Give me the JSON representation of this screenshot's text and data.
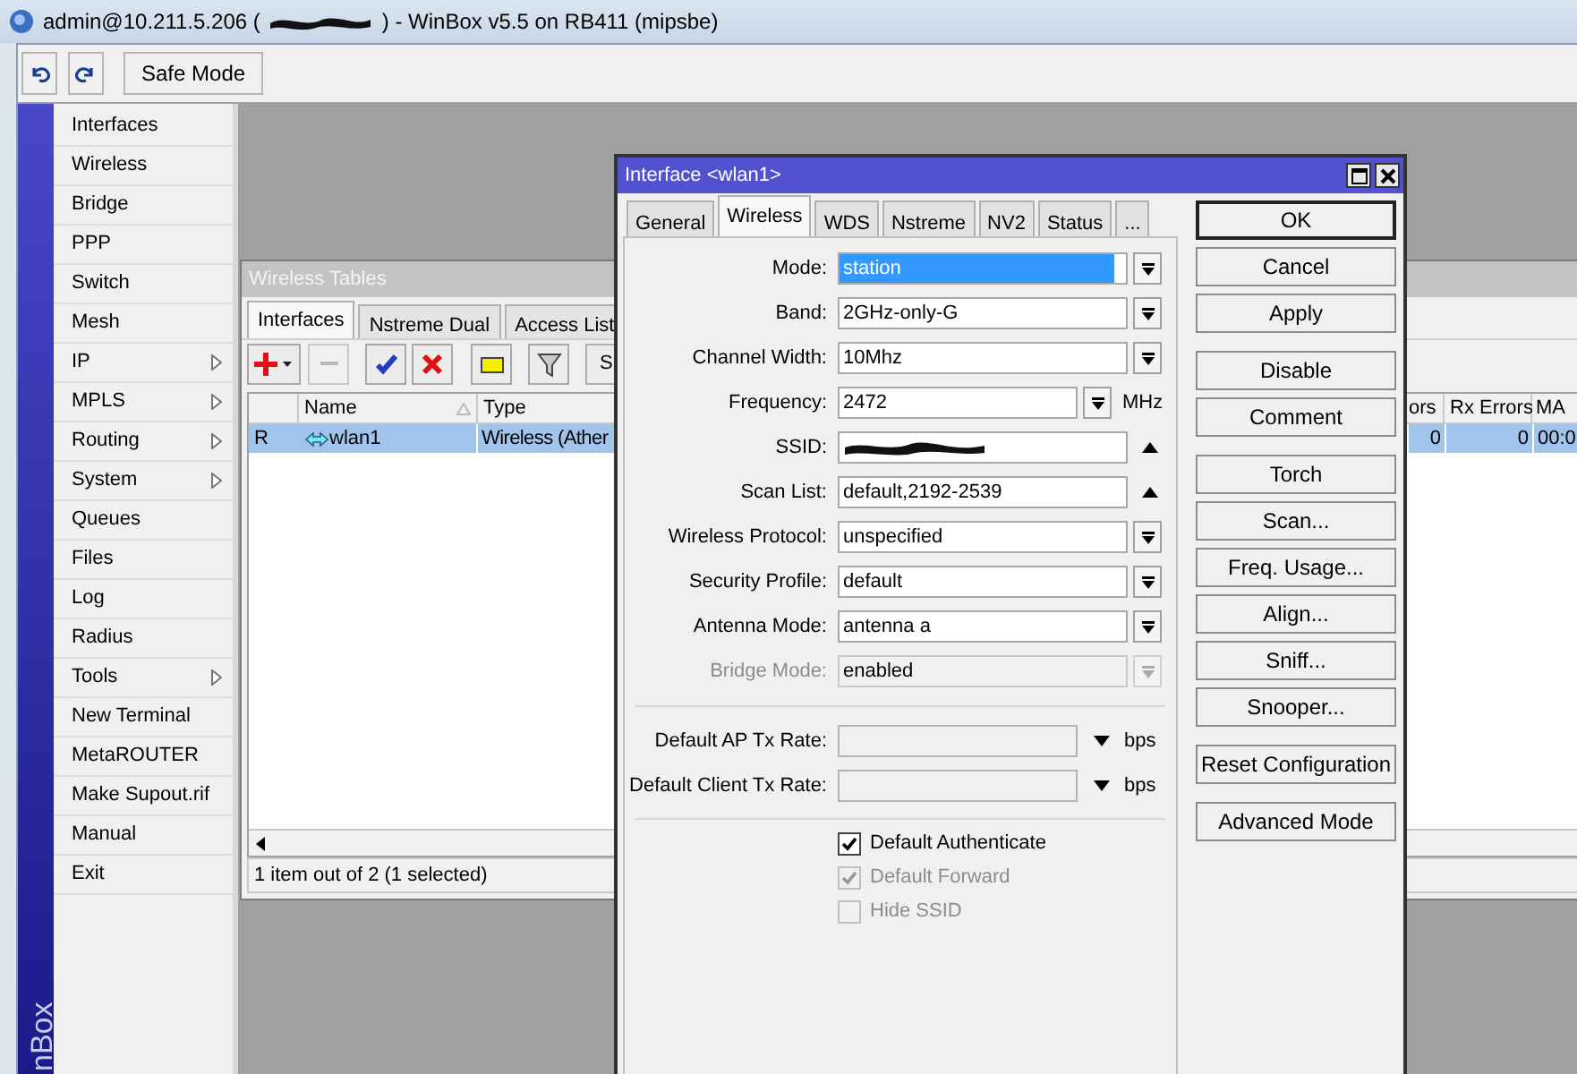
{
  "window": {
    "title_start": "admin@10.211.5.206 (",
    "title_end": ") - WinBox v5.5 on RB411 (mipsbe)"
  },
  "toolbar": {
    "buttons": [
      {
        "kind": "undo"
      },
      {
        "kind": "redo"
      },
      {
        "kind": "text",
        "label": "Safe Mode"
      }
    ]
  },
  "sidebar": {
    "brand": "nBox",
    "items": [
      {
        "label": "Interfaces",
        "submenu": false
      },
      {
        "label": "Wireless",
        "submenu": false
      },
      {
        "label": "Bridge",
        "submenu": false
      },
      {
        "label": "PPP",
        "submenu": false
      },
      {
        "label": "Switch",
        "submenu": false
      },
      {
        "label": "Mesh",
        "submenu": false
      },
      {
        "label": "IP",
        "submenu": true
      },
      {
        "label": "MPLS",
        "submenu": true
      },
      {
        "label": "Routing",
        "submenu": true
      },
      {
        "label": "System",
        "submenu": true
      },
      {
        "label": "Queues",
        "submenu": false
      },
      {
        "label": "Files",
        "submenu": false
      },
      {
        "label": "Log",
        "submenu": false
      },
      {
        "label": "Radius",
        "submenu": false
      },
      {
        "label": "Tools",
        "submenu": true
      },
      {
        "label": "New Terminal",
        "submenu": false
      },
      {
        "label": "MetaROUTER",
        "submenu": false
      },
      {
        "label": "Make Supout.rif",
        "submenu": false
      },
      {
        "label": "Manual",
        "submenu": false
      },
      {
        "label": "Exit",
        "submenu": false
      }
    ]
  },
  "tables_window": {
    "title": "Wireless Tables",
    "tabs": [
      {
        "label": "Interfaces",
        "selected": true
      },
      {
        "label": "Nstreme Dual",
        "selected": false
      },
      {
        "label": "Access List",
        "selected": false
      }
    ],
    "toolbar": [
      {
        "kind": "add",
        "disabled": false
      },
      {
        "kind": "remove",
        "disabled": true
      },
      {
        "kind": "enable",
        "disabled": false
      },
      {
        "kind": "disable",
        "disabled": false
      },
      {
        "kind": "comment",
        "disabled": false
      },
      {
        "kind": "filter",
        "disabled": false
      },
      {
        "kind": "text",
        "label": "S",
        "disabled": false
      }
    ],
    "columns_left": [
      "Name",
      "Type"
    ],
    "columns_right": [
      "ors",
      "Rx Errors",
      "MA"
    ],
    "rows": [
      {
        "flag": "R",
        "name": "wlan1",
        "type": "Wireless (Ather",
        "column_ors": "0",
        "rx_errors": "0",
        "mac": "00:0",
        "selected": true
      }
    ],
    "status": "1 item out of 2 (1 selected)"
  },
  "dialog": {
    "title": "Interface <wlan1>",
    "tabs": [
      {
        "label": "General",
        "selected": false
      },
      {
        "label": "Wireless",
        "selected": true
      },
      {
        "label": "WDS",
        "selected": false
      },
      {
        "label": "Nstreme",
        "selected": false
      },
      {
        "label": "NV2",
        "selected": false
      },
      {
        "label": "Status",
        "selected": false
      },
      {
        "label": "...",
        "selected": false
      }
    ],
    "fields": [
      {
        "kind": "select",
        "label": "Mode:",
        "value": "station",
        "selected": true,
        "disabled": false
      },
      {
        "kind": "select",
        "label": "Band:",
        "value": "2GHz-only-G",
        "selected": false,
        "disabled": false
      },
      {
        "kind": "select",
        "label": "Channel Width:",
        "value": "10Mhz",
        "selected": false,
        "disabled": false
      },
      {
        "kind": "combo",
        "label": "Frequency:",
        "value": "2472",
        "unit": "MHz",
        "selected": false,
        "disabled": false
      },
      {
        "kind": "redacted",
        "label": "SSID:",
        "selected": false,
        "disabled": false
      },
      {
        "kind": "list",
        "label": "Scan List:",
        "value": "default,2192-2539",
        "selected": false,
        "disabled": false
      },
      {
        "kind": "select",
        "label": "Wireless Protocol:",
        "value": "unspecified",
        "selected": false,
        "disabled": false
      },
      {
        "kind": "select",
        "label": "Security Profile:",
        "value": "default",
        "selected": false,
        "disabled": false
      },
      {
        "kind": "select",
        "label": "Antenna Mode:",
        "value": "antenna a",
        "selected": false,
        "disabled": false
      },
      {
        "kind": "select",
        "label": "Bridge Mode:",
        "value": "enabled",
        "selected": false,
        "disabled": true
      }
    ],
    "rates": [
      {
        "label": "Default AP Tx Rate:",
        "unit": "bps"
      },
      {
        "label": "Default Client Tx Rate:",
        "unit": "bps"
      }
    ],
    "checkboxes": [
      {
        "label": "Default Authenticate",
        "checked": true,
        "disabled": false
      },
      {
        "label": "Default Forward",
        "checked": true,
        "disabled": true
      },
      {
        "label": "Hide SSID",
        "checked": false,
        "disabled": true
      }
    ],
    "button_groups": [
      [
        {
          "label": "OK",
          "default": true
        },
        {
          "label": "Cancel",
          "default": false
        },
        {
          "label": "Apply",
          "default": false
        }
      ],
      [
        {
          "label": "Disable",
          "default": false
        },
        {
          "label": "Comment",
          "default": false
        }
      ],
      [
        {
          "label": "Torch",
          "default": false
        },
        {
          "label": "Scan...",
          "default": false
        },
        {
          "label": "Freq. Usage...",
          "default": false
        },
        {
          "label": "Align...",
          "default": false
        },
        {
          "label": "Sniff...",
          "default": false
        },
        {
          "label": "Snooper...",
          "default": false
        }
      ],
      [
        {
          "label": "Reset Configuration",
          "default": false
        }
      ],
      [
        {
          "label": "Advanced Mode",
          "default": false
        }
      ]
    ]
  }
}
